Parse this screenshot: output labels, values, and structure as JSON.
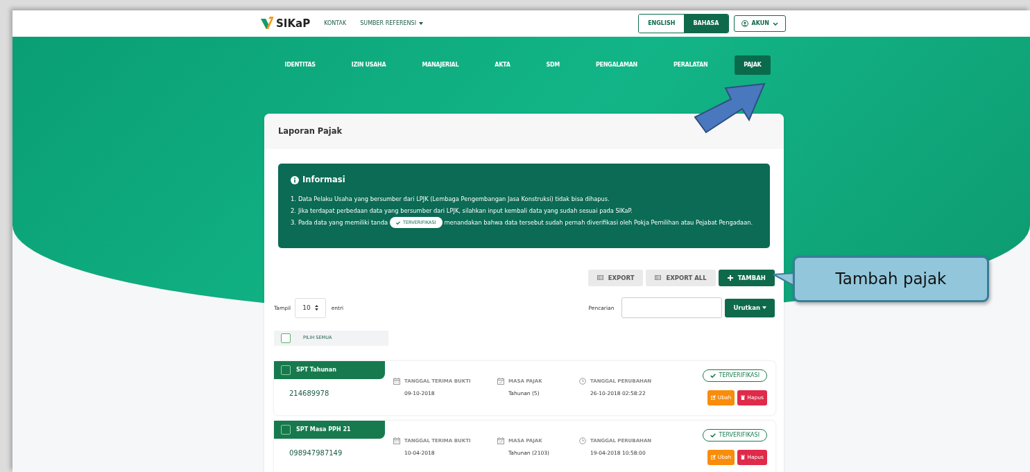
{
  "navbar": {
    "brand": "SIKaP",
    "links": [
      {
        "label": "KONTAK",
        "dropdown": false
      },
      {
        "label": "SUMBER REFERENSI",
        "dropdown": true
      }
    ],
    "languages": [
      {
        "label": "ENGLISH",
        "selected": false
      },
      {
        "label": "BAHASA",
        "selected": true
      }
    ],
    "account": "AKUN"
  },
  "tabs": [
    {
      "label": "IDENTITAS",
      "selected": false
    },
    {
      "label": "IZIN USAHA",
      "selected": false
    },
    {
      "label": "MANAJERIAL",
      "selected": false
    },
    {
      "label": "AKTA",
      "selected": false
    },
    {
      "label": "SDM",
      "selected": false
    },
    {
      "label": "PENGALAMAN",
      "selected": false
    },
    {
      "label": "PERALATAN",
      "selected": false
    },
    {
      "label": "PAJAK",
      "selected": true
    }
  ],
  "card": {
    "title": "Laporan Pajak",
    "info": {
      "title": "Informasi",
      "items": [
        {
          "number": "1.",
          "text": "Data Pelaku Usaha yang bersumber dari LPJK (Lembaga Pengembangan Jasa Konstruksi) tidak bisa dihapus."
        },
        {
          "number": "2.",
          "text": "Jika terdapat perbedaan data yang bersumber dari LPJK, silahkan input kembali data yang sudah sesuai pada SIKaP."
        },
        {
          "number": "3.",
          "before": "Pada data yang memiliki tanda",
          "badge": "TERVERIFIKASI",
          "after": "menandakan bahwa data tersebut sudah pernah diverifikasi oleh Pokja Pemilihan atau Pejabat Pengadaan."
        }
      ]
    },
    "toolbar": [
      {
        "kind": "export",
        "label": "EXPORT"
      },
      {
        "kind": "export",
        "label": "EXPORT ALL"
      },
      {
        "kind": "add",
        "label": "TAMBAH"
      }
    ],
    "page_size": {
      "label": "Tampil",
      "value": "10",
      "suffix": "entri"
    },
    "search": {
      "label": "Pencarian"
    },
    "sort_button": "Urutkan",
    "select_all": {
      "label": "PILIH SEMUA",
      "checked": false
    },
    "records": [
      {
        "type": "SPT Tahunan",
        "checked": false,
        "number": "214689978",
        "fields": [
          {
            "kind": "calendar",
            "label": "TANGGAL TERIMA BUKTI",
            "value": "09-10-2018"
          },
          {
            "kind": "calendar-check",
            "label": "MASA PAJAK",
            "value": "Tahunan (5)"
          },
          {
            "kind": "clock",
            "label": "TANGGAL PERUBAHAN",
            "value": "26-10-2018 02:58:22"
          }
        ],
        "status": "TERVERIFIKASI",
        "actions": [
          {
            "kind": "edit",
            "label": "Ubah"
          },
          {
            "kind": "delete",
            "label": "Hapus"
          }
        ]
      },
      {
        "type": "SPT Masa PPH 21",
        "checked": false,
        "number": "098947987149",
        "fields": [
          {
            "kind": "calendar",
            "label": "TANGGAL TERIMA BUKTI",
            "value": "10-04-2018"
          },
          {
            "kind": "calendar-check",
            "label": "MASA PAJAK",
            "value": "Tahunan (2103)"
          },
          {
            "kind": "clock",
            "label": "TANGGAL PERUBAHAN",
            "value": "19-04-2018 10:58:00"
          }
        ],
        "status": "TERVERIFIKASI",
        "actions": [
          {
            "kind": "edit",
            "label": "Ubah"
          },
          {
            "kind": "delete",
            "label": "Hapus"
          }
        ]
      }
    ]
  },
  "callout": {
    "text": "Tambah pajak"
  }
}
